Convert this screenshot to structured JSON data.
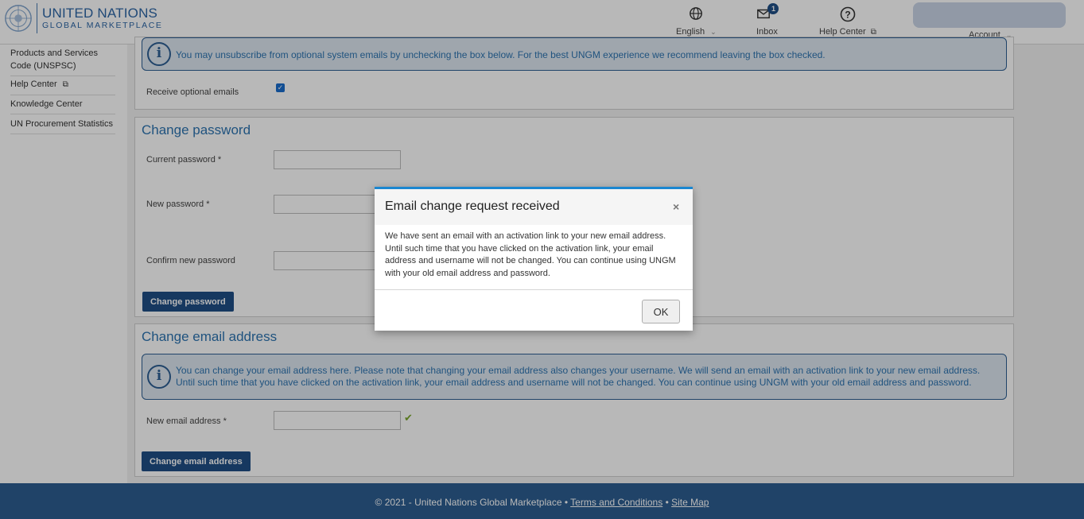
{
  "header": {
    "logo_line1": "UNITED NATIONS",
    "logo_line2": "GLOBAL MARKETPLACE",
    "language_label": "English",
    "inbox_label": "Inbox",
    "inbox_badge": "1",
    "help_label": "Help Center",
    "account_label": "Account"
  },
  "sidebar": {
    "items": [
      {
        "label": "Products and Services Code (UNSPSC)"
      },
      {
        "label": "Help Center"
      },
      {
        "label": "Knowledge Center"
      },
      {
        "label": "UN Procurement Statistics"
      }
    ]
  },
  "email_prefs": {
    "info_text": "You may unsubscribe from optional system emails by unchecking the box below. For the best UNGM experience we recommend leaving the box checked.",
    "checkbox_label": "Receive optional emails",
    "checked": true
  },
  "change_password": {
    "title": "Change password",
    "current_label": "Current password *",
    "new_label": "New password *",
    "confirm_label": "Confirm new password",
    "button_label": "Change password"
  },
  "change_email": {
    "title": "Change email address",
    "info_text": "You can change your email address here. Please note that changing your email address also changes your username. We will send an email with an activation link to your new email address. Until such time that you have clicked on the activation link, your email address and username will not be changed. You can continue using UNGM with your old email address and password.",
    "new_email_label": "New email address *",
    "button_label": "Change email address"
  },
  "footer": {
    "copyright": "© 2021 - United Nations Global Marketplace •",
    "terms": "Terms and Conditions",
    "sep": "•",
    "sitemap": "Site Map"
  },
  "modal": {
    "title": "Email change request received",
    "close": "×",
    "body": "We have sent an email with an activation link to your new email address. Until such time that you have clicked on the activation link, your email address and username will not be changed. You can continue using UNGM with your old email address and password.",
    "ok_label": "OK"
  },
  "colors": {
    "brand_blue": "#2d66a6",
    "primary_button": "#1f4e85",
    "footer_bg": "#2d5e91",
    "modal_accent": "#1a86d0"
  }
}
